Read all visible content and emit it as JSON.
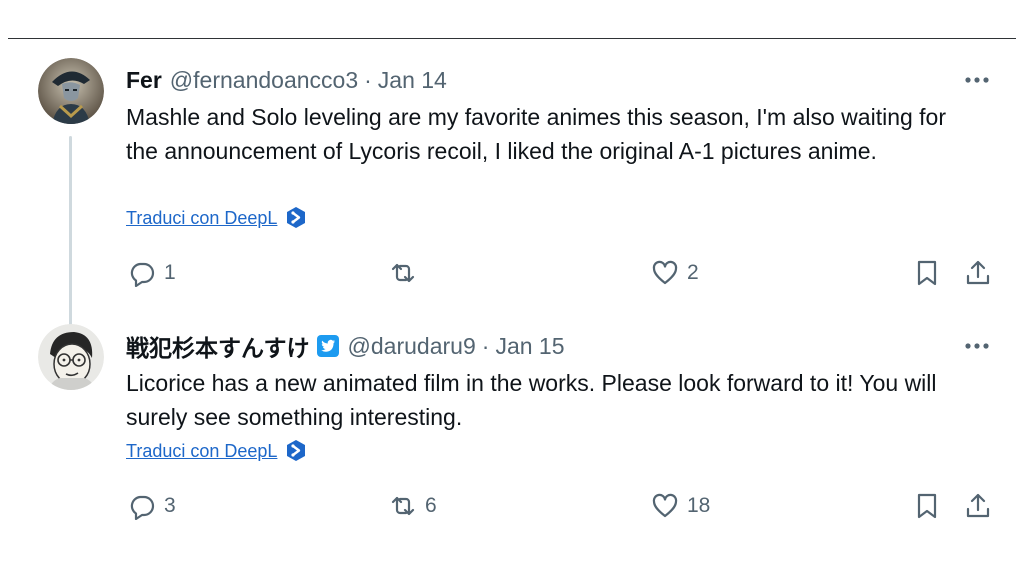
{
  "tweets": [
    {
      "display_name": "Fer",
      "handle": "@fernandoancco3",
      "separator": "·",
      "date": "Jan 14",
      "verified": false,
      "text": "Mashle and Solo leveling are my favorite animes this season, I'm also waiting for the announcement of Lycoris recoil, I liked the original A-1 pictures anime.",
      "translate_label": "Traduci con DeepL",
      "actions": {
        "replies": "1",
        "reposts": "",
        "likes": "2"
      }
    },
    {
      "display_name": "戦犯杉本すんすけ",
      "handle": "@darudaru9",
      "separator": "·",
      "date": "Jan 15",
      "verified": true,
      "text": "Licorice has a new animated film in the works. Please look forward to it! You will surely see something interesting.",
      "translate_label": "Traduci con DeepL",
      "actions": {
        "replies": "3",
        "reposts": "6",
        "likes": "18"
      }
    }
  ],
  "icons": {
    "more": "more-horizontal-icon",
    "reply": "reply-icon",
    "repost": "repost-icon",
    "like": "heart-icon",
    "bookmark": "bookmark-icon",
    "share": "share-icon",
    "deepl": "deepl-icon",
    "verified": "twitter-bird-verified-icon"
  },
  "colors": {
    "text": "#0f1419",
    "muted": "#536471",
    "link": "#1d67c9",
    "thread_line": "#cfd9de",
    "verified": "#1d9bf0"
  }
}
